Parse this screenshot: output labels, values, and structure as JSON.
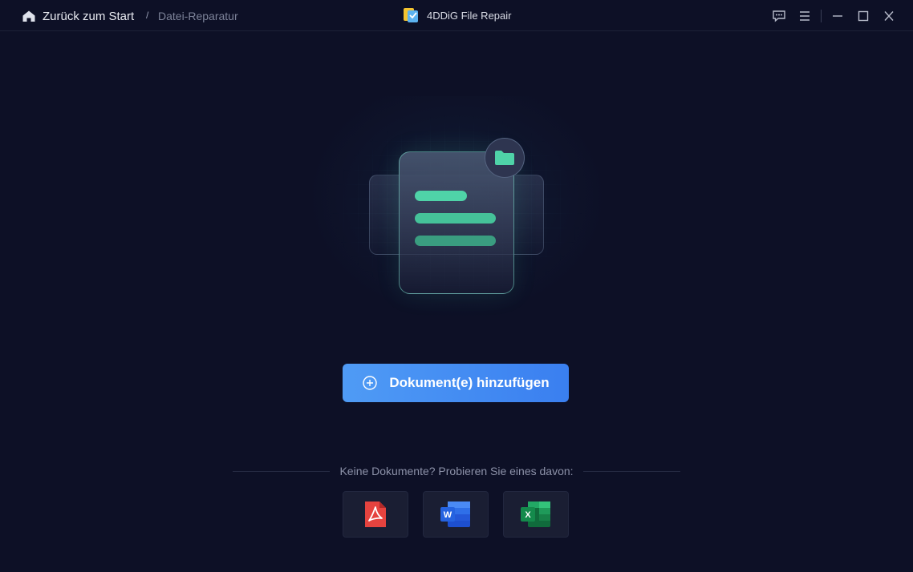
{
  "titlebar": {
    "back_label": "Zurück zum Start",
    "separator": "/",
    "current_page": "Datei-Reparatur",
    "app_name": "4DDiG File Repair"
  },
  "window_controls": [
    "feedback-icon",
    "menu-icon",
    "minimize-icon",
    "maximize-icon",
    "close-icon"
  ],
  "main": {
    "add_button_label": "Dokument(e) hinzufügen",
    "samples_prompt": "Keine Dokumente? Probieren Sie eines davon:",
    "sample_files": [
      {
        "type": "pdf",
        "icon": "pdf-file-icon",
        "color": "#e5433f"
      },
      {
        "type": "word",
        "icon": "word-file-icon",
        "color": "#2b6ff0"
      },
      {
        "type": "excel",
        "icon": "excel-file-icon",
        "color": "#1e9e5a"
      }
    ]
  },
  "colors": {
    "background": "#0d1026",
    "accent_button": "#3f8ef3",
    "illustration_green": "#4fd3a8"
  }
}
